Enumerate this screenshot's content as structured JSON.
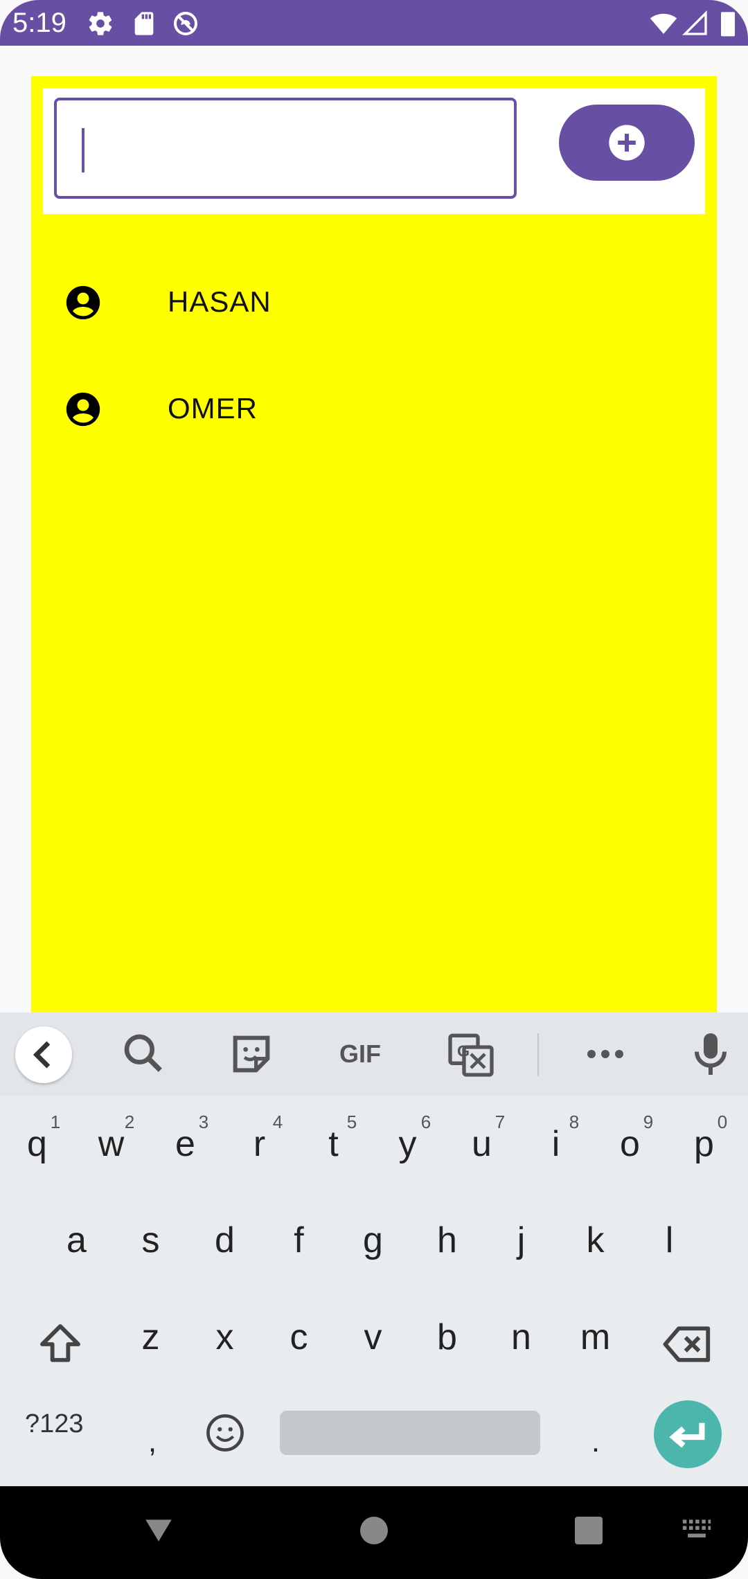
{
  "status_bar": {
    "time": "5:19",
    "color": "#6750a4",
    "icons_left": [
      "settings-icon",
      "sd-card-icon",
      "no-disturb-icon"
    ],
    "icons_right": [
      "wifi-icon",
      "signal-icon",
      "battery-icon"
    ]
  },
  "form": {
    "input_value": "",
    "add_icon": "plus-circle-icon"
  },
  "list": {
    "background": "#ffff00",
    "items": [
      {
        "label": "HASAN",
        "icon": "account-circle-icon"
      },
      {
        "label": "OMER",
        "icon": "account-circle-icon"
      }
    ]
  },
  "keyboard": {
    "toolbar": [
      "back-icon",
      "search-icon",
      "sticker-icon",
      "gif-icon",
      "translate-icon",
      "more-icon",
      "mic-icon"
    ],
    "gif_label": "GIF",
    "row1": [
      "q",
      "w",
      "e",
      "r",
      "t",
      "y",
      "u",
      "i",
      "o",
      "p"
    ],
    "row1_hints": [
      "1",
      "2",
      "3",
      "4",
      "5",
      "6",
      "7",
      "8",
      "9",
      "0"
    ],
    "row2": [
      "a",
      "s",
      "d",
      "f",
      "g",
      "h",
      "j",
      "k",
      "l"
    ],
    "row3": [
      "z",
      "x",
      "c",
      "v",
      "b",
      "n",
      "m"
    ],
    "sym_label": "?123",
    "comma": ",",
    "period": ".",
    "enter_color": "#4db6ac"
  },
  "nav_bar": {
    "buttons": [
      "back-triangle-icon",
      "home-circle-icon",
      "recents-square-icon",
      "keyboard-switch-icon"
    ]
  }
}
